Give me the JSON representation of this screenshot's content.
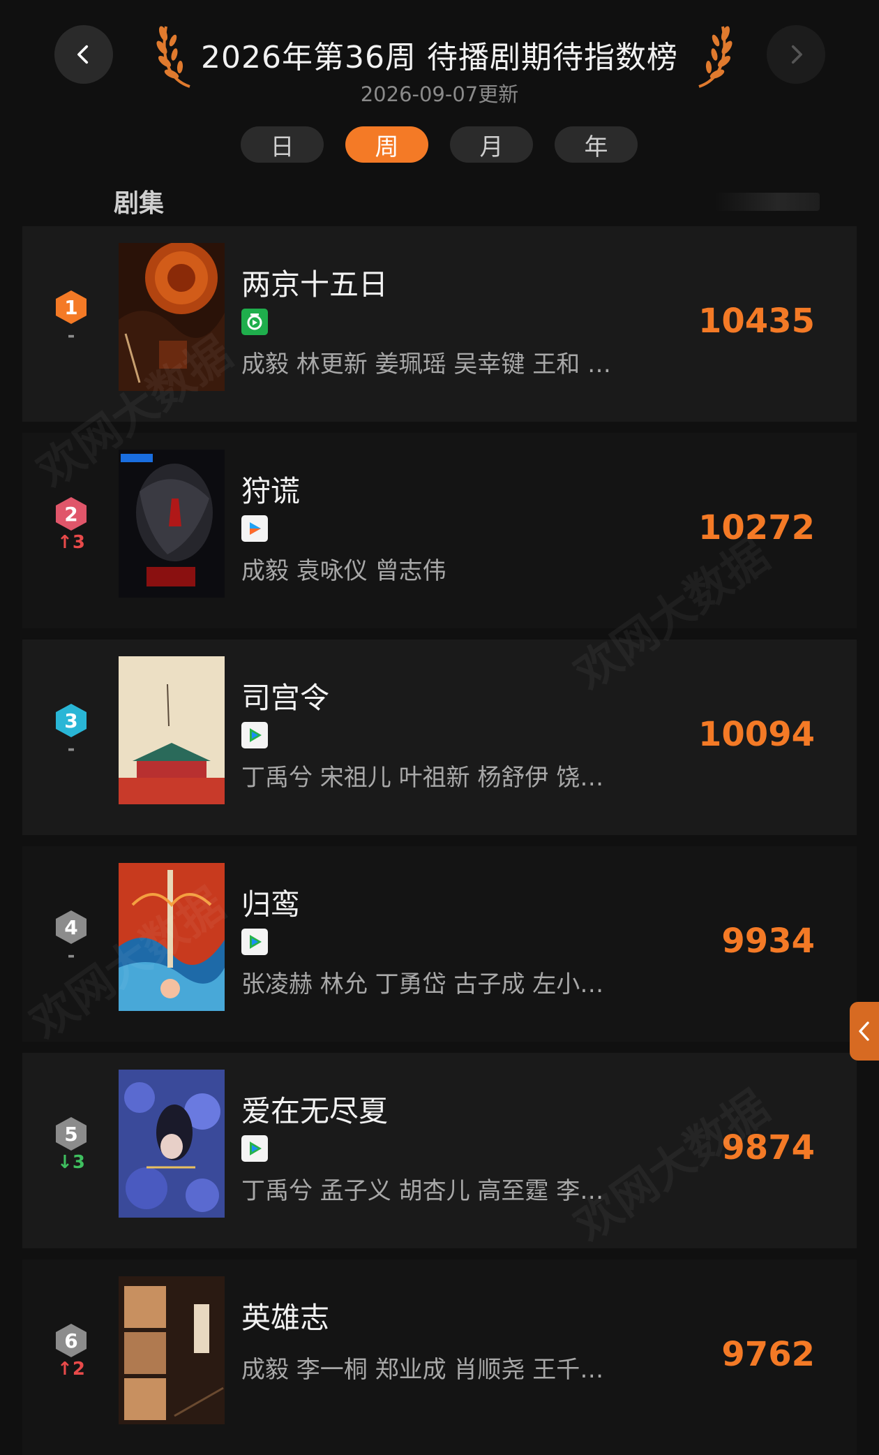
{
  "header": {
    "title": "2026年第36周 待播剧期待指数榜",
    "updated": "2026-09-07更新",
    "tabs": [
      "日",
      "周",
      "月",
      "年"
    ],
    "active_tab": "周"
  },
  "section": {
    "label": "剧集"
  },
  "watermark": "欢网大数据",
  "colors": {
    "accent": "#f47a26",
    "rank1": "#f47a26",
    "rank2": "#e0566a",
    "rank3": "#29b6d6",
    "rank_other": "#8c8c8c",
    "up": "#e84a4a",
    "down": "#3fbf5f"
  },
  "items": [
    {
      "rank": "1",
      "change": "-",
      "change_type": "none",
      "name": "两京十五日",
      "platform": "iqiyi-icon",
      "cast": "成毅 林更新 姜珮瑶 吴幸键 王和 …",
      "score": "10435"
    },
    {
      "rank": "2",
      "change": "↑3",
      "change_type": "up",
      "name": "狩谎",
      "platform": "youku-icon",
      "cast": "成毅 袁咏仪 曾志伟",
      "score": "10272"
    },
    {
      "rank": "3",
      "change": "-",
      "change_type": "none",
      "name": "司宫令",
      "platform": "tencent-video-icon",
      "cast": "丁禹兮 宋祖儿 叶祖新 杨舒伊 饶…",
      "score": "10094"
    },
    {
      "rank": "4",
      "change": "-",
      "change_type": "none",
      "name": "归鸾",
      "platform": "tencent-video-icon",
      "cast": "张凌赫 林允 丁勇岱 古子成 左小…",
      "score": "9934"
    },
    {
      "rank": "5",
      "change": "↓3",
      "change_type": "down",
      "name": "爱在无尽夏",
      "platform": "tencent-video-icon",
      "cast": "丁禹兮 孟子义 胡杏儿 高至霆 李…",
      "score": "9874"
    },
    {
      "rank": "6",
      "change": "↑2",
      "change_type": "up",
      "name": "英雄志",
      "platform": "",
      "cast": "成毅 李一桐 郑业成 肖顺尧 王千…",
      "score": "9762"
    }
  ]
}
